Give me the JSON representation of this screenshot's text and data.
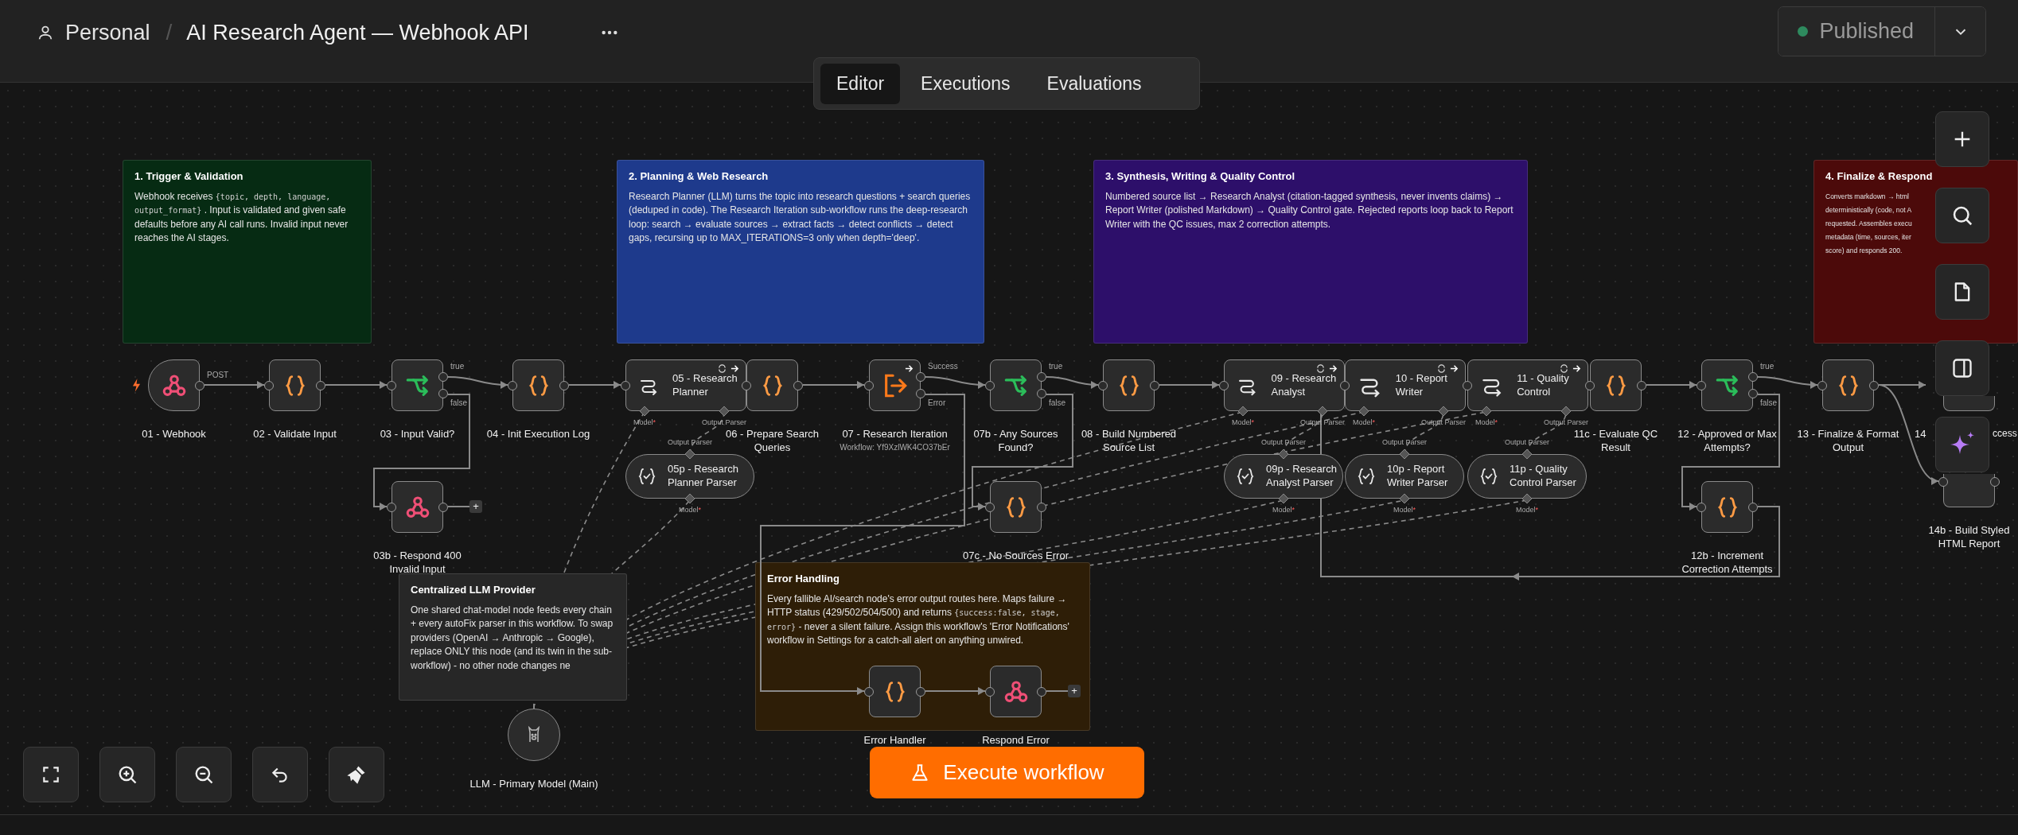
{
  "header": {
    "owner": "Personal",
    "separator": "/",
    "workflow_title": "AI Research Agent — Webhook API"
  },
  "publish": {
    "label": "Published",
    "published": true
  },
  "view_tabs": [
    {
      "label": "Editor",
      "selected": true
    },
    {
      "label": "Executions",
      "selected": false
    },
    {
      "label": "Evaluations",
      "selected": false
    }
  ],
  "sticky_notes": [
    {
      "title": "1. Trigger & Validation",
      "color": "#062b13",
      "text": [
        {
          "text": "Webhook receives "
        },
        {
          "text": "{topic, depth, language, output_format}",
          "code": true
        },
        {
          "text": " . Input is validated and given safe defaults before any AI call runs. Invalid input never reaches the AI stages."
        }
      ]
    },
    {
      "title": "2. Planning & Web Research",
      "color": "#1e3a8c",
      "text": [
        {
          "text": "Research Planner (LLM) turns the topic into research questions + search queries (deduped in code). The Research Iteration sub-workflow runs the deep-research loop: search → evaluate sources → extract facts → detect conflicts → detect gaps, recursing up to MAX_ITERATIONS=3 only when depth='deep'."
        }
      ]
    },
    {
      "title": "3. Synthesis, Writing & Quality Control",
      "color": "#2d0f6a",
      "text": [
        {
          "text": "Numbered source list → Research Analyst (citation-tagged synthesis, never invents claims) → Report Writer (polished Markdown) → Quality Control gate. Rejected reports loop back to Report Writer with the QC issues, max 2 correction attempts."
        }
      ]
    },
    {
      "title": "4. Finalize & Respond",
      "color": "#4c0a0a",
      "lines": [
        "Converts markdown → html",
        "deterministically (code, not A",
        "requested. Assembles execu",
        "metadata (time, sources, iter",
        "score) and responds 200."
      ]
    },
    {
      "title": "Centralized LLM Provider",
      "color": "#272727",
      "text": [
        {
          "text": "One shared chat-model node feeds every chain + every autoFix parser in this workflow. To swap providers (OpenAI → Anthropic → Google), replace ONLY this node (and its twin in the sub-workflow) - no other node changes ne"
        }
      ]
    },
    {
      "title": "Error Handling",
      "color": "#2e1e07",
      "text": [
        {
          "text": "Every fallible AI/search node's error output routes here. Maps failure → HTTP status (429/502/504/500) and returns "
        },
        {
          "text": "{success:false, stage, error}",
          "code": true
        },
        {
          "text": " - never a silent failure. Assign this workflow's 'Error Notifications' workflow in Settings for a catch-all alert on anything unwired."
        }
      ]
    }
  ],
  "nodes": [
    {
      "label": "01 - Webhook",
      "kind": "trigger",
      "outputs": [
        "POST"
      ]
    },
    {
      "label": "02 - Validate Input",
      "kind": "code"
    },
    {
      "label": "03 - Input Valid?",
      "kind": "if",
      "outputs": [
        "true",
        "false"
      ]
    },
    {
      "label": "04 - Init Execution Log",
      "kind": "code"
    },
    {
      "label": "05 - Research Planner",
      "kind": "chain",
      "handles": [
        {
          "label": "Model",
          "mark": "*"
        },
        {
          "label": "Output Parser"
        }
      ]
    },
    {
      "label": "06 - Prepare Search Queries",
      "kind": "code"
    },
    {
      "label": "07 - Research Iteration",
      "kind": "subworkflow",
      "sublabel": "Workflow: Yf9XzlWK4CO37bEr",
      "outputs": [
        "Success",
        "Error"
      ]
    },
    {
      "label": "07b - Any Sources Found?",
      "kind": "if",
      "outputs": [
        "true",
        "false"
      ]
    },
    {
      "label": "08 - Build Numbered Source List",
      "kind": "code"
    },
    {
      "label": "09 - Research Analyst",
      "kind": "chain",
      "handles": [
        {
          "label": "Model",
          "mark": "*"
        },
        {
          "label": "Output Parser"
        }
      ]
    },
    {
      "label": "10 - Report Writer",
      "kind": "chain",
      "handles": [
        {
          "label": "Model",
          "mark": "*"
        },
        {
          "label": "Output Parser"
        }
      ]
    },
    {
      "label": "11 - Quality Control",
      "kind": "chain",
      "handles": [
        {
          "label": "Model",
          "mark": "*"
        },
        {
          "label": "Output Parser"
        }
      ]
    },
    {
      "label": "11c - Evaluate QC Result",
      "kind": "code"
    },
    {
      "label": "12 - Approved or Max Attempts?",
      "kind": "if",
      "outputs": [
        "true",
        "false"
      ]
    },
    {
      "label": "13 - Finalize & Format Output",
      "kind": "code"
    },
    {
      "label": "14",
      "label_tail": "ccess",
      "kind": "code"
    },
    {
      "label": "03b - Respond 400 Invalid Input",
      "kind": "respond",
      "add": "+"
    },
    {
      "label": "05p - Research Planner Parser",
      "kind": "parser",
      "top_handle": {
        "label": "Output Parser"
      },
      "handles": [
        {
          "label": "Model",
          "mark": "*"
        }
      ]
    },
    {
      "label": "07c - No Sources Error",
      "kind": "code"
    },
    {
      "label": "09p - Research Analyst Parser",
      "kind": "parser",
      "top_handle": {
        "label": "Output Parser"
      },
      "handles": [
        {
          "label": "Model",
          "mark": "*"
        }
      ]
    },
    {
      "label": "10p - Report Writer Parser",
      "kind": "parser",
      "top_handle": {
        "label": "Output Parser"
      },
      "handles": [
        {
          "label": "Model",
          "mark": "*"
        }
      ]
    },
    {
      "label": "11p - Quality Control Parser",
      "kind": "parser",
      "top_handle": {
        "label": "Output Parser"
      },
      "handles": [
        {
          "label": "Model",
          "mark": "*"
        }
      ]
    },
    {
      "label": "12b - Increment Correction Attempts",
      "kind": "code"
    },
    {
      "label": "14b - Build Styled HTML Report",
      "kind": "code"
    },
    {
      "label": "LLM - Primary Model (Main)",
      "kind": "model"
    },
    {
      "label": "Error Handler",
      "kind": "code"
    },
    {
      "label": "Respond Error",
      "kind": "respond",
      "add": "+"
    }
  ],
  "execute_button": {
    "label": "Execute workflow"
  }
}
